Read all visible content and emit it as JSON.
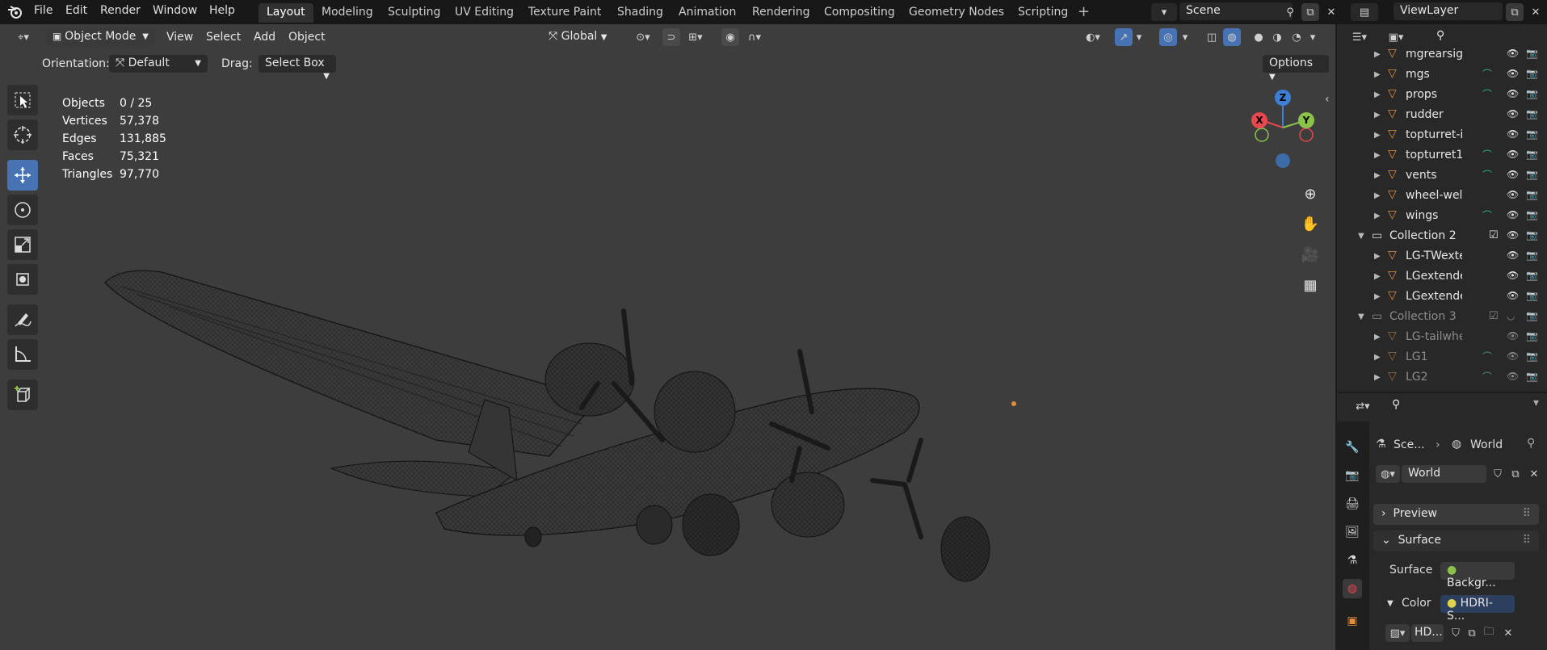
{
  "menu": [
    "File",
    "Edit",
    "Render",
    "Window",
    "Help"
  ],
  "workspaces": [
    {
      "label": "Layout",
      "active": true
    },
    {
      "label": "Modeling"
    },
    {
      "label": "Sculpting"
    },
    {
      "label": "UV Editing"
    },
    {
      "label": "Texture Paint"
    },
    {
      "label": "Shading"
    },
    {
      "label": "Animation"
    },
    {
      "label": "Rendering"
    },
    {
      "label": "Compositing"
    },
    {
      "label": "Geometry Nodes"
    },
    {
      "label": "Scripting"
    }
  ],
  "scene": {
    "name": "Scene"
  },
  "view_layer": {
    "name": "ViewLayer"
  },
  "viewport_header": {
    "mode": "Object Mode",
    "view": "View",
    "select": "Select",
    "add": "Add",
    "object": "Object",
    "transform_orientation": "Global",
    "orientation_label": "Orientation:",
    "orientation_value": "Default",
    "drag_label": "Drag:",
    "drag_value": "Select Box",
    "options": "Options"
  },
  "stats": [
    {
      "label": "Objects",
      "value": "0 / 25"
    },
    {
      "label": "Vertices",
      "value": "57,378"
    },
    {
      "label": "Edges",
      "value": "131,885"
    },
    {
      "label": "Faces",
      "value": "75,321"
    },
    {
      "label": "Triangles",
      "value": "97,770"
    }
  ],
  "gizmo": {
    "x": "X",
    "y": "Y",
    "z": "Z"
  },
  "outliner": [
    {
      "name": "mgrearsigh",
      "type": "mesh",
      "modifier": false
    },
    {
      "name": "mgs",
      "type": "mesh",
      "modifier": true
    },
    {
      "name": "props",
      "type": "mesh",
      "modifier": true
    },
    {
      "name": "rudder",
      "type": "mesh",
      "modifier": false
    },
    {
      "name": "topturret-ir",
      "type": "mesh",
      "modifier": false
    },
    {
      "name": "topturret1",
      "type": "mesh",
      "modifier": true
    },
    {
      "name": "vents",
      "type": "mesh",
      "modifier": true
    },
    {
      "name": "wheel-wells",
      "type": "mesh",
      "modifier": false
    },
    {
      "name": "wings",
      "type": "mesh",
      "modifier": true
    },
    {
      "name": "Collection 2",
      "type": "collection",
      "modifier": false
    },
    {
      "name": "LG-TWexte",
      "type": "mesh",
      "modifier": false
    },
    {
      "name": "LGextende",
      "type": "mesh",
      "modifier": false
    },
    {
      "name": "LGextende",
      "type": "mesh",
      "modifier": false
    },
    {
      "name": "Collection 3",
      "type": "collection",
      "modifier": false,
      "dim": true
    },
    {
      "name": "LG-tailwhe",
      "type": "mesh",
      "modifier": false,
      "dim": true
    },
    {
      "name": "LG1",
      "type": "mesh",
      "modifier": true,
      "dim": true
    },
    {
      "name": "LG2",
      "type": "mesh",
      "modifier": true,
      "dim": true
    }
  ],
  "properties": {
    "breadcrumb_scene": "Sce...",
    "breadcrumb_world": "World",
    "world_name": "World",
    "panels": {
      "preview": "Preview",
      "surface": "Surface"
    },
    "surface_label": "Surface",
    "surface_value": "Backgr...",
    "color_label": "Color",
    "color_value": "HDRI-S...",
    "image_name": "HD..."
  },
  "colors": {
    "accent": "#4772b3",
    "object_orange": "#e08d3c",
    "axis_x": "#e8474d",
    "axis_y": "#8bc34a",
    "axis_z": "#3d7fd6"
  }
}
